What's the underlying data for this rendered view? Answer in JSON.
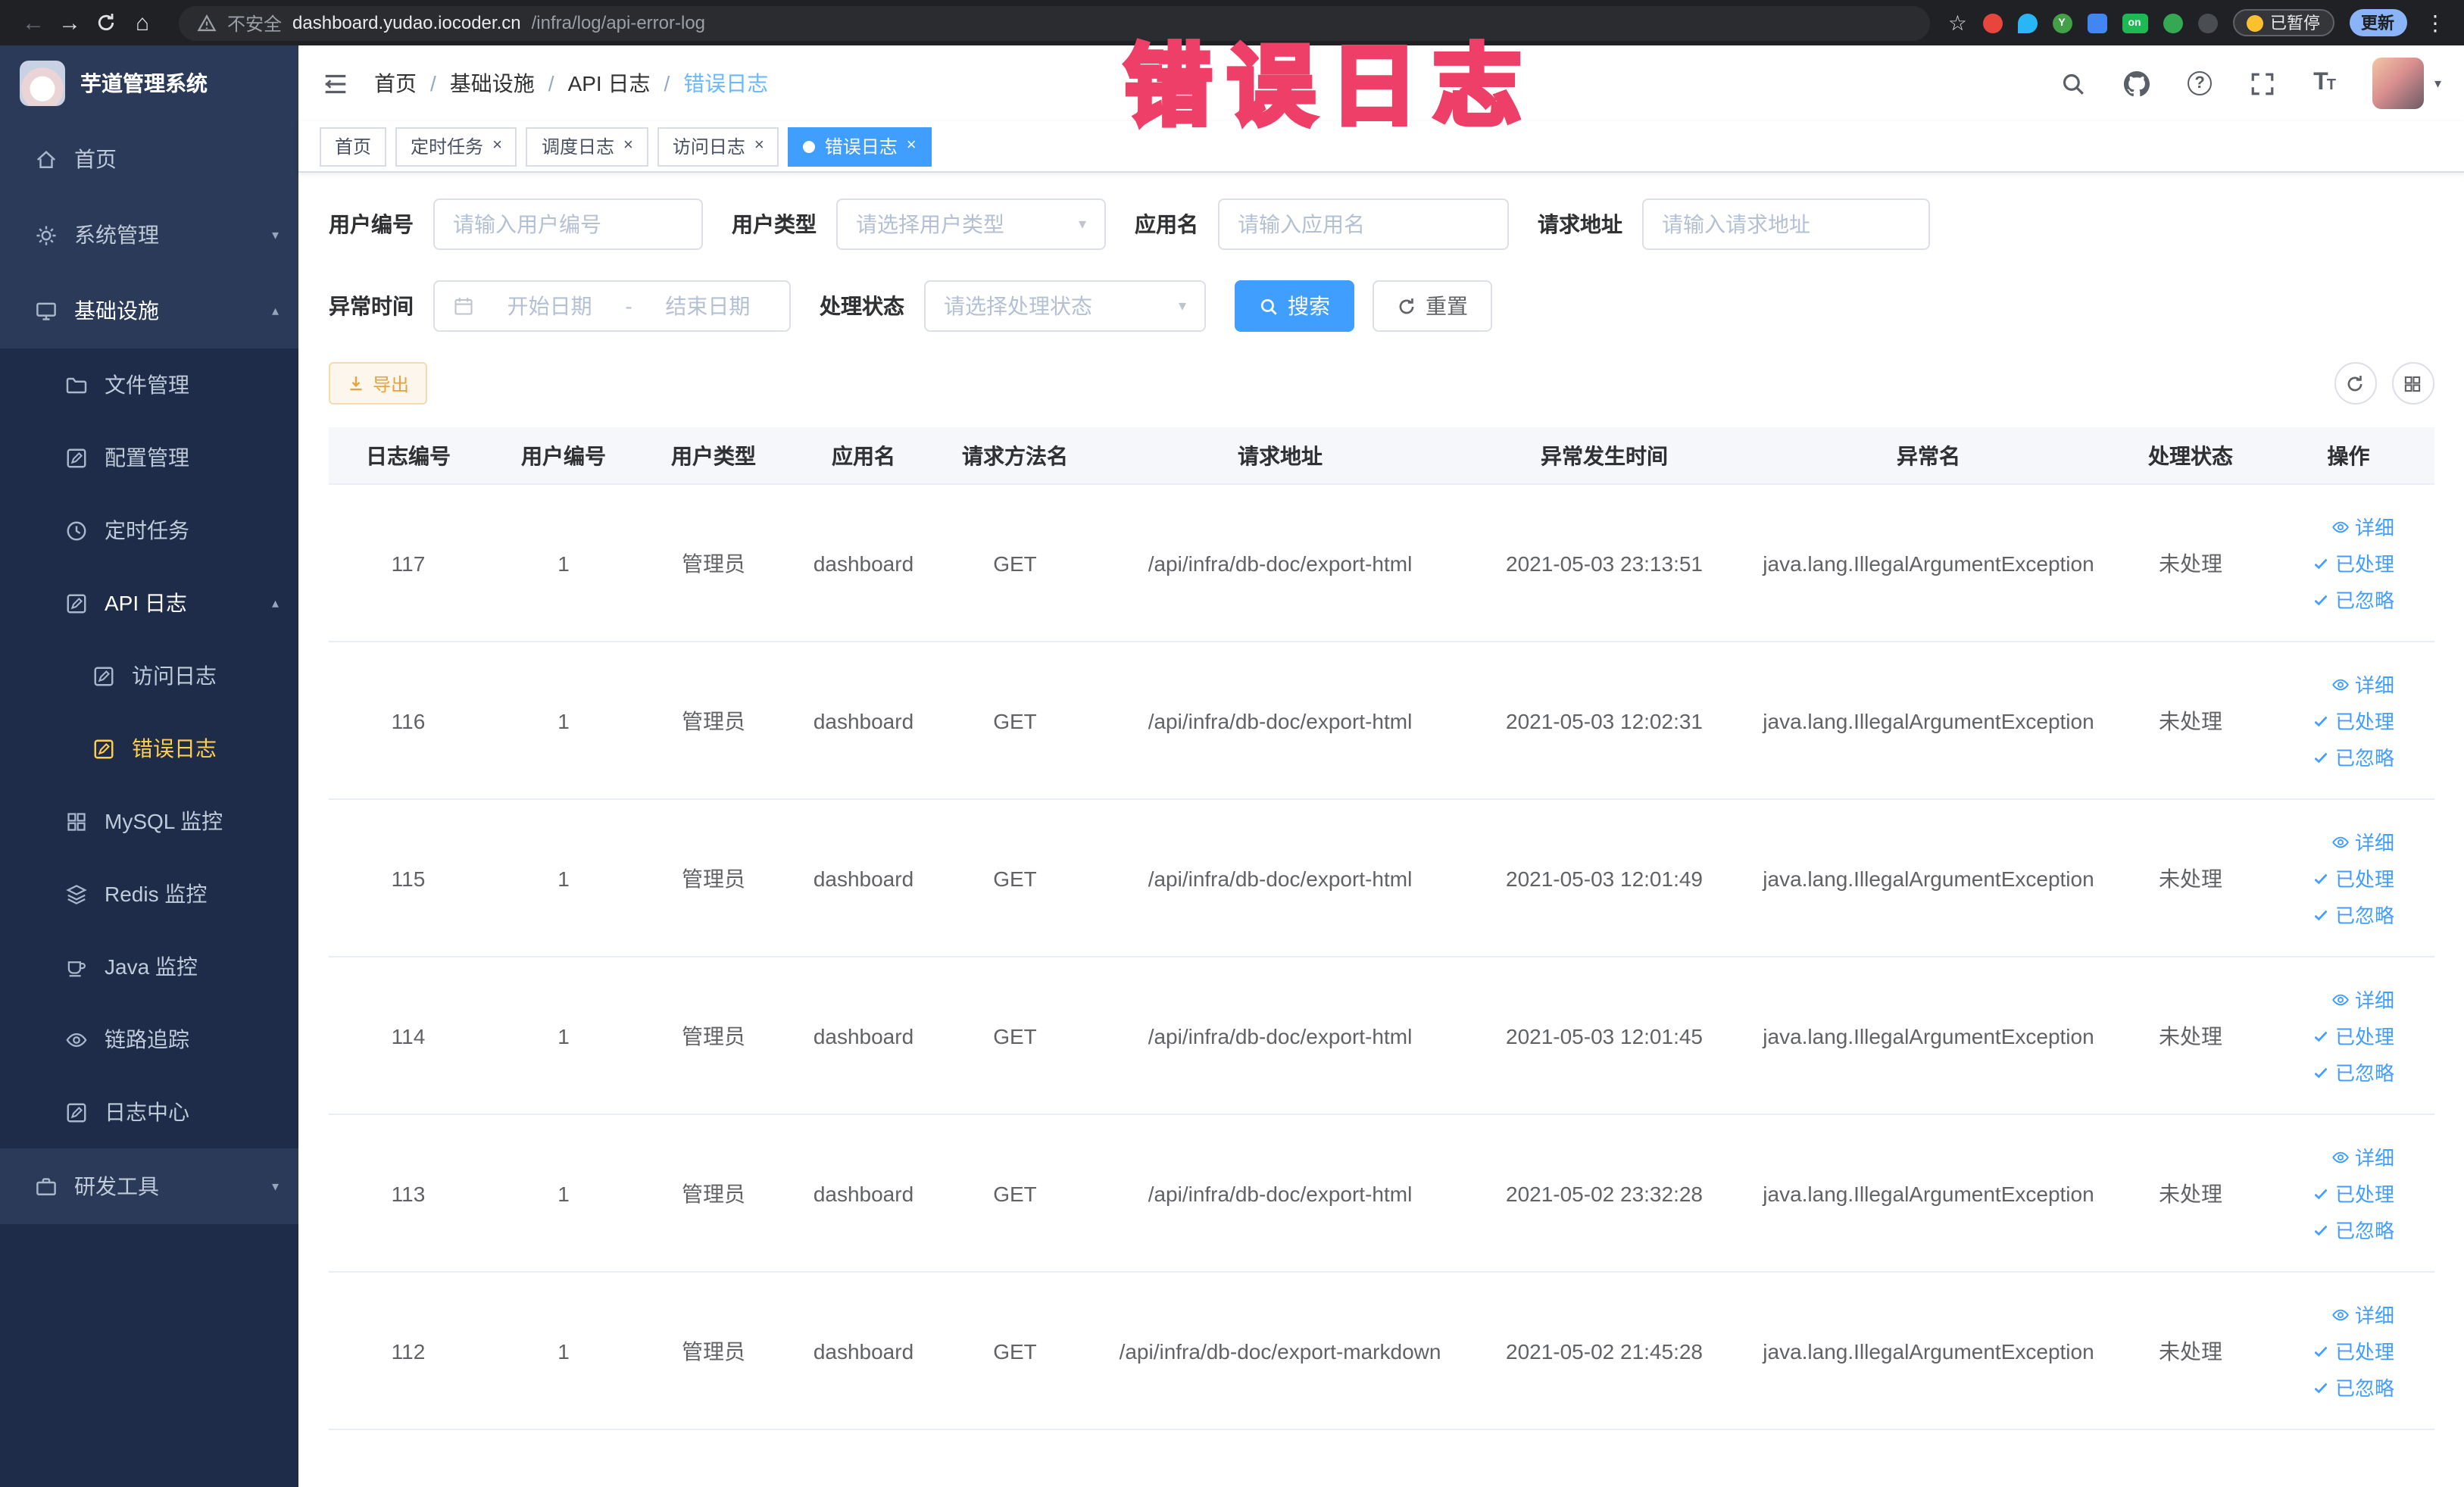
{
  "annotation": {
    "text": "错误日志"
  },
  "browser": {
    "security_label": "不安全",
    "url_host": "dashboard.yudao.iocoder.cn",
    "url_path": "/infra/log/api-error-log",
    "ext_on_badge": "on",
    "paused_badge": "已暂停",
    "update_button": "更新"
  },
  "sidebar": {
    "title": "芋道管理系统",
    "items": [
      {
        "label": "首页"
      },
      {
        "label": "系统管理"
      },
      {
        "label": "基础设施"
      },
      {
        "label": "文件管理"
      },
      {
        "label": "配置管理"
      },
      {
        "label": "定时任务"
      },
      {
        "label": "API 日志"
      },
      {
        "label": "访问日志"
      },
      {
        "label": "错误日志"
      },
      {
        "label": "MySQL 监控"
      },
      {
        "label": "Redis 监控"
      },
      {
        "label": "Java 监控"
      },
      {
        "label": "链路追踪"
      },
      {
        "label": "日志中心"
      },
      {
        "label": "研发工具"
      }
    ]
  },
  "header": {
    "breadcrumb": [
      "首页",
      "基础设施",
      "API 日志",
      "错误日志"
    ]
  },
  "tabs": [
    {
      "label": "首页"
    },
    {
      "label": "定时任务"
    },
    {
      "label": "调度日志"
    },
    {
      "label": "访问日志"
    },
    {
      "label": "错误日志"
    }
  ],
  "filters": {
    "user_id": {
      "label": "用户编号",
      "placeholder": "请输入用户编号"
    },
    "user_type": {
      "label": "用户类型",
      "placeholder": "请选择用户类型"
    },
    "app_name": {
      "label": "应用名",
      "placeholder": "请输入应用名"
    },
    "request_url": {
      "label": "请求地址",
      "placeholder": "请输入请求地址"
    },
    "exception_time": {
      "label": "异常时间",
      "start_placeholder": "开始日期",
      "separator": "-",
      "end_placeholder": "结束日期"
    },
    "process_status": {
      "label": "处理状态",
      "placeholder": "请选择处理状态"
    },
    "search_button": "搜索",
    "reset_button": "重置"
  },
  "toolbar": {
    "export_button": "导出"
  },
  "table": {
    "columns": [
      "日志编号",
      "用户编号",
      "用户类型",
      "应用名",
      "请求方法名",
      "请求地址",
      "异常发生时间",
      "异常名",
      "处理状态",
      "操作"
    ],
    "row_actions": {
      "detail": "详细",
      "processed": "已处理",
      "ignored": "已忽略"
    },
    "rows": [
      {
        "id": "117",
        "user_id": "1",
        "user_type": "管理员",
        "app": "dashboard",
        "method": "GET",
        "url": "/api/infra/db-doc/export-html",
        "time": "2021-05-03 23:13:51",
        "exception": "java.lang.IllegalArgumentException",
        "status": "未处理"
      },
      {
        "id": "116",
        "user_id": "1",
        "user_type": "管理员",
        "app": "dashboard",
        "method": "GET",
        "url": "/api/infra/db-doc/export-html",
        "time": "2021-05-03 12:02:31",
        "exception": "java.lang.IllegalArgumentException",
        "status": "未处理"
      },
      {
        "id": "115",
        "user_id": "1",
        "user_type": "管理员",
        "app": "dashboard",
        "method": "GET",
        "url": "/api/infra/db-doc/export-html",
        "time": "2021-05-03 12:01:49",
        "exception": "java.lang.IllegalArgumentException",
        "status": "未处理"
      },
      {
        "id": "114",
        "user_id": "1",
        "user_type": "管理员",
        "app": "dashboard",
        "method": "GET",
        "url": "/api/infra/db-doc/export-html",
        "time": "2021-05-03 12:01:45",
        "exception": "java.lang.IllegalArgumentException",
        "status": "未处理"
      },
      {
        "id": "113",
        "user_id": "1",
        "user_type": "管理员",
        "app": "dashboard",
        "method": "GET",
        "url": "/api/infra/db-doc/export-html",
        "time": "2021-05-02 23:32:28",
        "exception": "java.lang.IllegalArgumentException",
        "status": "未处理"
      },
      {
        "id": "112",
        "user_id": "1",
        "user_type": "管理员",
        "app": "dashboard",
        "method": "GET",
        "url": "/api/infra/db-doc/export-markdown",
        "time": "2021-05-02 21:45:28",
        "exception": "java.lang.IllegalArgumentException",
        "status": "未处理"
      }
    ]
  }
}
